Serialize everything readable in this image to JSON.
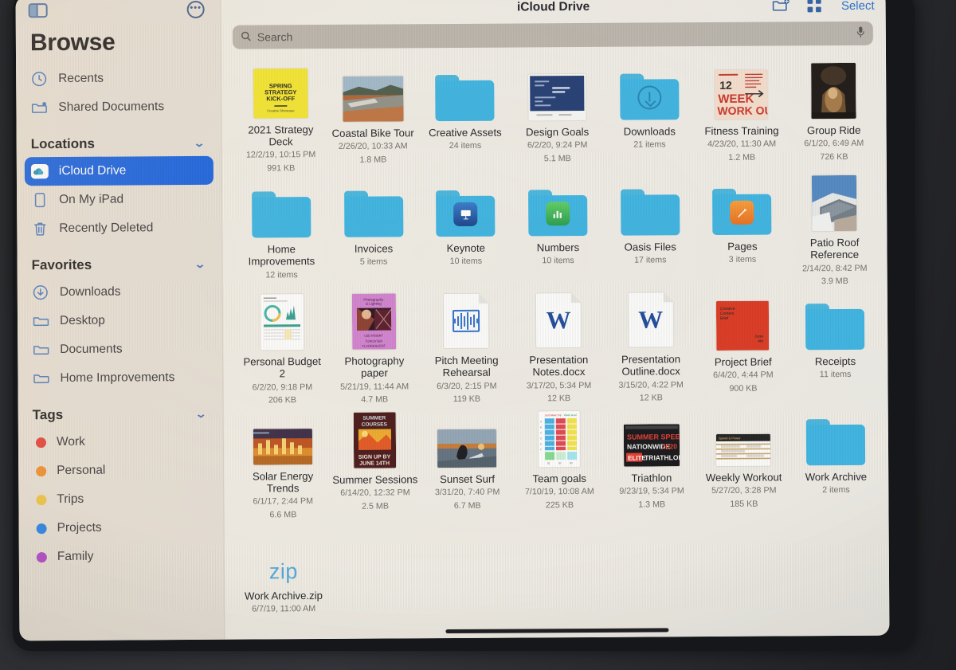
{
  "sidebar": {
    "toggle_icon": "sidebar-toggle-icon",
    "more_icon": "more-ellipsis-icon",
    "title": "Browse",
    "quick_items": [
      {
        "label": "Recents",
        "icon": "clock-icon"
      },
      {
        "label": "Shared Documents",
        "icon": "shared-folder-icon"
      }
    ],
    "sections": [
      {
        "header": "Locations",
        "items": [
          {
            "label": "iCloud Drive",
            "icon": "icloud-icon",
            "selected": true
          },
          {
            "label": "On My iPad",
            "icon": "ipad-icon",
            "selected": false
          },
          {
            "label": "Recently Deleted",
            "icon": "trash-icon",
            "selected": false
          }
        ]
      },
      {
        "header": "Favorites",
        "items": [
          {
            "label": "Downloads",
            "icon": "download-circle-icon",
            "selected": false
          },
          {
            "label": "Desktop",
            "icon": "folder-outline-icon",
            "selected": false
          },
          {
            "label": "Documents",
            "icon": "folder-outline-icon",
            "selected": false
          },
          {
            "label": "Home Improvements",
            "icon": "folder-outline-icon",
            "selected": false
          }
        ]
      },
      {
        "header": "Tags",
        "items": [
          {
            "label": "Work",
            "icon": "tag-dot-icon",
            "color": "#ea3b34"
          },
          {
            "label": "Personal",
            "icon": "tag-dot-icon",
            "color": "#f28a22"
          },
          {
            "label": "Trips",
            "icon": "tag-dot-icon",
            "color": "#f0c237"
          },
          {
            "label": "Projects",
            "icon": "tag-dot-icon",
            "color": "#1a7ff0"
          },
          {
            "label": "Family",
            "icon": "tag-dot-icon",
            "color": "#b33fd0"
          }
        ]
      }
    ]
  },
  "topbar": {
    "title": "iCloud Drive",
    "new_folder_icon": "new-folder-icon",
    "view_grid_icon": "grid-view-icon",
    "select_label": "Select"
  },
  "search": {
    "placeholder": "Search",
    "value": "",
    "search_icon": "search-icon",
    "mic_icon": "microphone-icon"
  },
  "files": [
    {
      "name": "2021 Strategy Deck",
      "meta1": "12/2/19, 10:15 PM",
      "meta2": "991 KB",
      "kind": "image",
      "art": "strategy-deck"
    },
    {
      "name": "Coastal Bike Tour",
      "meta1": "2/26/20, 10:33 AM",
      "meta2": "1.8 MB",
      "kind": "image",
      "art": "coastal-bike"
    },
    {
      "name": "Creative Assets",
      "meta1": "24 items",
      "meta2": "",
      "kind": "folder",
      "art": "plain"
    },
    {
      "name": "Design Goals",
      "meta1": "6/2/20, 9:24 PM",
      "meta2": "5.1 MB",
      "kind": "image",
      "art": "design-goals"
    },
    {
      "name": "Downloads",
      "meta1": "21 items",
      "meta2": "",
      "kind": "folder",
      "art": "download"
    },
    {
      "name": "Fitness Training",
      "meta1": "4/23/20, 11:30 AM",
      "meta2": "1.2 MB",
      "kind": "image",
      "art": "fitness"
    },
    {
      "name": "Group Ride",
      "meta1": "6/1/20, 6:49 AM",
      "meta2": "726 KB",
      "kind": "image",
      "art": "group-ride"
    },
    {
      "name": "Home Improvements",
      "meta1": "12 items",
      "meta2": "",
      "kind": "folder",
      "art": "plain"
    },
    {
      "name": "Invoices",
      "meta1": "5 items",
      "meta2": "",
      "kind": "folder",
      "art": "plain"
    },
    {
      "name": "Keynote",
      "meta1": "10 items",
      "meta2": "",
      "kind": "folder",
      "art": "keynote"
    },
    {
      "name": "Numbers",
      "meta1": "10 items",
      "meta2": "",
      "kind": "folder",
      "art": "numbers"
    },
    {
      "name": "Oasis Files",
      "meta1": "17 items",
      "meta2": "",
      "kind": "folder",
      "art": "plain"
    },
    {
      "name": "Pages",
      "meta1": "3 items",
      "meta2": "",
      "kind": "folder",
      "art": "pages"
    },
    {
      "name": "Patio Roof Reference",
      "meta1": "2/14/20, 8:42 PM",
      "meta2": "3.9 MB",
      "kind": "image",
      "art": "patio-roof"
    },
    {
      "name": "Personal Budget 2",
      "meta1": "6/2/20, 9:18 PM",
      "meta2": "206 KB",
      "kind": "image",
      "art": "budget"
    },
    {
      "name": "Photography paper",
      "meta1": "5/21/19, 11:44 AM",
      "meta2": "4.7 MB",
      "kind": "image",
      "art": "photography"
    },
    {
      "name": "Pitch Meeting Rehearsal",
      "meta1": "6/3/20, 2:15 PM",
      "meta2": "119 KB",
      "kind": "audio",
      "art": "audio"
    },
    {
      "name": "Presentation Notes.docx",
      "meta1": "3/17/20, 5:34 PM",
      "meta2": "12 KB",
      "kind": "word",
      "art": "word"
    },
    {
      "name": "Presentation Outline.docx",
      "meta1": "3/15/20, 4:22 PM",
      "meta2": "12 KB",
      "kind": "word",
      "art": "word"
    },
    {
      "name": "Project Brief",
      "meta1": "6/4/20, 4:44 PM",
      "meta2": "900 KB",
      "kind": "image",
      "art": "project-brief"
    },
    {
      "name": "Receipts",
      "meta1": "11 items",
      "meta2": "",
      "kind": "folder",
      "art": "plain"
    },
    {
      "name": "Solar Energy Trends",
      "meta1": "6/1/17, 2:44 PM",
      "meta2": "6.6 MB",
      "kind": "image",
      "art": "solar"
    },
    {
      "name": "Summer Sessions",
      "meta1": "6/14/20, 12:32 PM",
      "meta2": "2.5 MB",
      "kind": "image",
      "art": "summer"
    },
    {
      "name": "Sunset Surf",
      "meta1": "3/31/20, 7:40 PM",
      "meta2": "6.7 MB",
      "kind": "image",
      "art": "sunset"
    },
    {
      "name": "Team goals",
      "meta1": "7/10/19, 10:08 AM",
      "meta2": "225 KB",
      "kind": "image",
      "art": "team-goals"
    },
    {
      "name": "Triathlon",
      "meta1": "9/23/19, 5:34 PM",
      "meta2": "1.3 MB",
      "kind": "image",
      "art": "triathlon"
    },
    {
      "name": "Weekly Workout",
      "meta1": "5/27/20, 3:28 PM",
      "meta2": "185 KB",
      "kind": "image",
      "art": "weekly-workout"
    },
    {
      "name": "Work Archive",
      "meta1": "2 items",
      "meta2": "",
      "kind": "folder",
      "art": "plain"
    },
    {
      "name": "Work Archive.zip",
      "meta1": "6/7/19, 11:00 AM",
      "meta2": "",
      "kind": "zip",
      "art": "zip"
    }
  ],
  "colors": {
    "accent_blue": "#1160e8",
    "folder_blue": "#33b4e5",
    "sidebar_bg": "#e4ded4",
    "content_bg": "#efece3",
    "link_blue": "#1f6fd6"
  }
}
